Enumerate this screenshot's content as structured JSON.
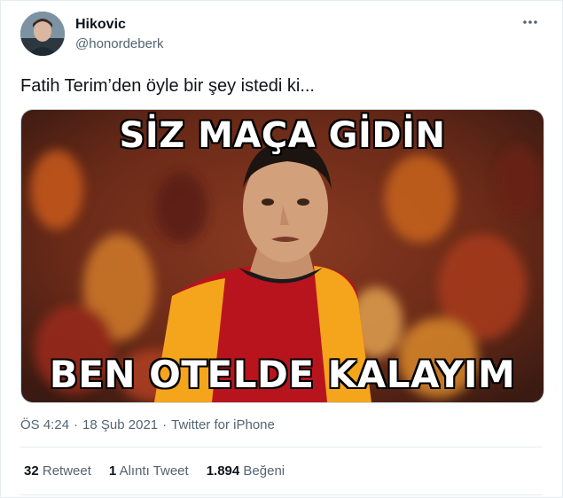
{
  "user": {
    "name": "Hikovic",
    "handle": "@honordeberk"
  },
  "tweet": {
    "text": "Fatih Terim’den öyle bir şey istedi ki...",
    "image": {
      "caption_top": "SİZ MAÇA GİDİN",
      "caption_bottom": "BEN OTELDE KALAYIM"
    },
    "time": "ÖS 4:24",
    "date": "18 Şub 2021",
    "separator": "·",
    "source": "Twitter for iPhone"
  },
  "stats": {
    "retweets_count": "32",
    "retweets_label": "Retweet",
    "quotes_count": "1",
    "quotes_label": "Alıntı Tweet",
    "likes_count": "1.894",
    "likes_label": "Beğeni"
  },
  "icons": {
    "more": "more-dots-icon"
  },
  "colors": {
    "text": "#0f1419",
    "secondary": "#536471",
    "divider": "#e6ecf0",
    "jersey_red": "#b8141e",
    "jersey_yellow": "#f5a51b"
  }
}
